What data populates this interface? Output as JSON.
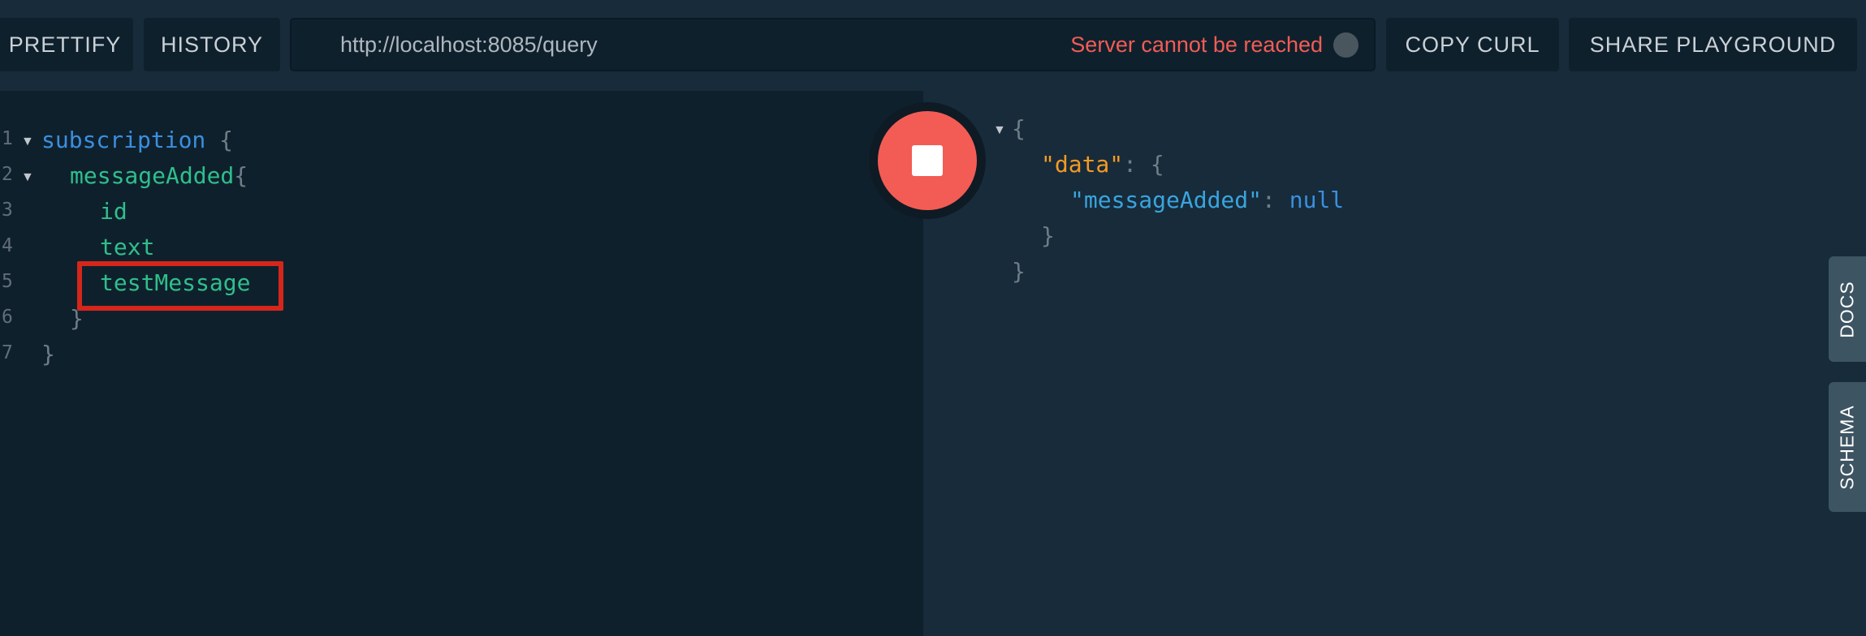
{
  "toolbar": {
    "prettify_label": "PRETTIFY",
    "history_label": "HISTORY",
    "copy_curl_label": "COPY CURL",
    "share_label": "SHARE PLAYGROUND"
  },
  "endpoint": {
    "url": "http://localhost:8085/query",
    "status_text": "Server cannot be reached"
  },
  "editor": {
    "line_numbers": [
      "1",
      "2",
      "3",
      "4",
      "5",
      "6",
      "7"
    ],
    "tokens": {
      "subscription": "subscription",
      "open_brace": "{",
      "messageAdded": "messageAdded",
      "id": "id",
      "text": "text",
      "testMessage": "testMessage",
      "close_brace": "}"
    }
  },
  "result": {
    "open_brace": "{",
    "data_key": "\"data\"",
    "colon": ":",
    "message_key": "\"messageAdded\"",
    "null_value": "null",
    "close_brace": "}"
  },
  "side_tabs": {
    "docs": "DOCS",
    "schema": "SCHEMA"
  },
  "icons": {
    "run": "stop-icon",
    "status": "status-dot-icon",
    "fold": "fold-arrow-icon"
  },
  "colors": {
    "error": "#f25c54",
    "highlight": "#d5261b",
    "keyword": "#3a8fde",
    "field": "#2fbf8b",
    "json_key": "#f59a23"
  }
}
